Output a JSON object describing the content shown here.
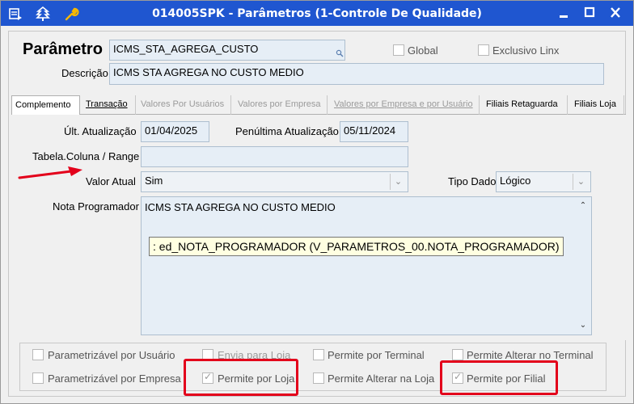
{
  "window": {
    "title": "014005SPK - Parâmetros (1-Controle De Qualidade)"
  },
  "header": {
    "parametro_label": "Parâmetro",
    "parametro_value": "ICMS_STA_AGREGA_CUSTO",
    "global_label": "Global",
    "exclusivo_label": "Exclusivo Linx",
    "descricao_label": "Descrição",
    "descricao_value": "ICMS STA AGREGA NO CUSTO MEDIO"
  },
  "tabs": [
    {
      "label": "Complemento",
      "state": "active"
    },
    {
      "label": "Transação",
      "state": "normal"
    },
    {
      "label": "Valores Por Usuários",
      "state": "disabled"
    },
    {
      "label": "Valores por Empresa",
      "state": "disabled"
    },
    {
      "label": "Valores por Empresa e por Usuário",
      "state": "disabled"
    },
    {
      "label": "Filiais Retaguarda",
      "state": "normal"
    },
    {
      "label": "Filiais Loja",
      "state": "normal"
    }
  ],
  "complemento": {
    "ult_atualizacao_label": "Últ. Atualização",
    "ult_atualizacao_value": "01/04/2025",
    "penultima_label": "Penúltima Atualização",
    "penultima_value": "05/11/2024",
    "tabela_label": "Tabela.Coluna / Range",
    "tabela_value": "",
    "valor_atual_label": "Valor Atual",
    "valor_atual_value": "Sim",
    "tipo_dado_label": "Tipo Dado",
    "tipo_dado_value": "Lógico",
    "nota_label": "Nota Programador",
    "nota_value": "ICMS STA AGREGA NO CUSTO MEDIO",
    "tooltip": ": ed_NOTA_PROGRAMADOR (V_PARAMETROS_00.NOTA_PROGRAMADOR)"
  },
  "options": {
    "parametrizavel_usuario": {
      "label": "Parametrizável por Usuário",
      "checked": false
    },
    "envia_loja": {
      "label": "Envia para Loja",
      "checked": false
    },
    "permite_terminal": {
      "label": "Permite por Terminal",
      "checked": false
    },
    "permite_alterar_terminal": {
      "label": "Permite Alterar no Terminal",
      "checked": false
    },
    "parametrizavel_empresa": {
      "label": "Parametrizável por Empresa",
      "checked": false
    },
    "permite_loja": {
      "label": "Permite por Loja",
      "checked": true
    },
    "permite_alterar_loja": {
      "label": "Permite Alterar na Loja",
      "checked": false
    },
    "permite_filial": {
      "label": "Permite por Filial",
      "checked": true
    }
  },
  "colors": {
    "titlebar": "#1f56d0",
    "highlight": "#e3001b",
    "field_bg": "#e6eef6"
  },
  "icons": [
    "menu-icon",
    "tree-icon",
    "wrench-icon",
    "minimize-icon",
    "maximize-icon",
    "close-icon",
    "annotation-arrow-icon"
  ]
}
